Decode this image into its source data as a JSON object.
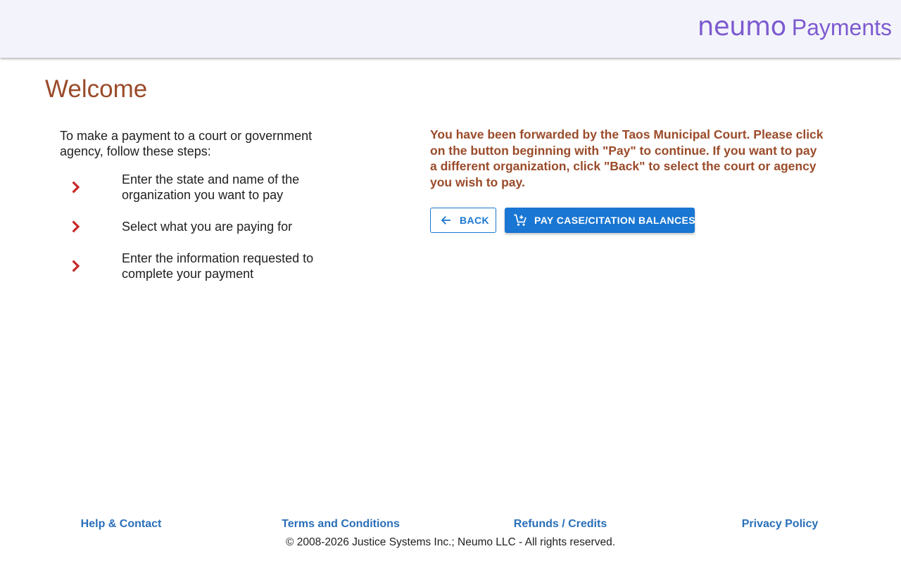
{
  "header": {
    "logo_word": "neumo",
    "logo_sub": "Payments"
  },
  "main": {
    "title": "Welcome",
    "intro": "To make a payment to a court or government agency, follow these steps:",
    "steps": [
      {
        "icon": "chevron-right-icon",
        "text": "Enter the state and name of the organization you want to pay"
      },
      {
        "icon": "chevron-right-icon",
        "text": "Select what you are paying for"
      },
      {
        "icon": "chevron-right-icon",
        "text": "Enter the information requested to complete your payment"
      }
    ],
    "forward_message": "You have been forwarded by the Taos Municipal Court. Please click on the button beginning with \"Pay\" to continue. If you want to pay a different organization, click \"Back\" to select the court or agency you wish to pay.",
    "back_button": {
      "icon": "arrow-left-icon",
      "label": "BACK"
    },
    "pay_button": {
      "icon": "cart-add-icon",
      "label": "PAY CASE/CITATION BALANCES"
    }
  },
  "footer": {
    "links": [
      "Help & Contact",
      "Terms and Conditions",
      "Refunds / Credits",
      "Privacy Policy"
    ],
    "copyright": "© 2008-2026 Justice Systems Inc.; Neumo LLC - All rights reserved."
  },
  "colors": {
    "header_bg": "#f3f4fb",
    "brand": "#7d5ad0",
    "heading": "#9a4b2a",
    "chevron": "#c62828",
    "primary": "#1976d2",
    "link": "#2a6fb8"
  }
}
